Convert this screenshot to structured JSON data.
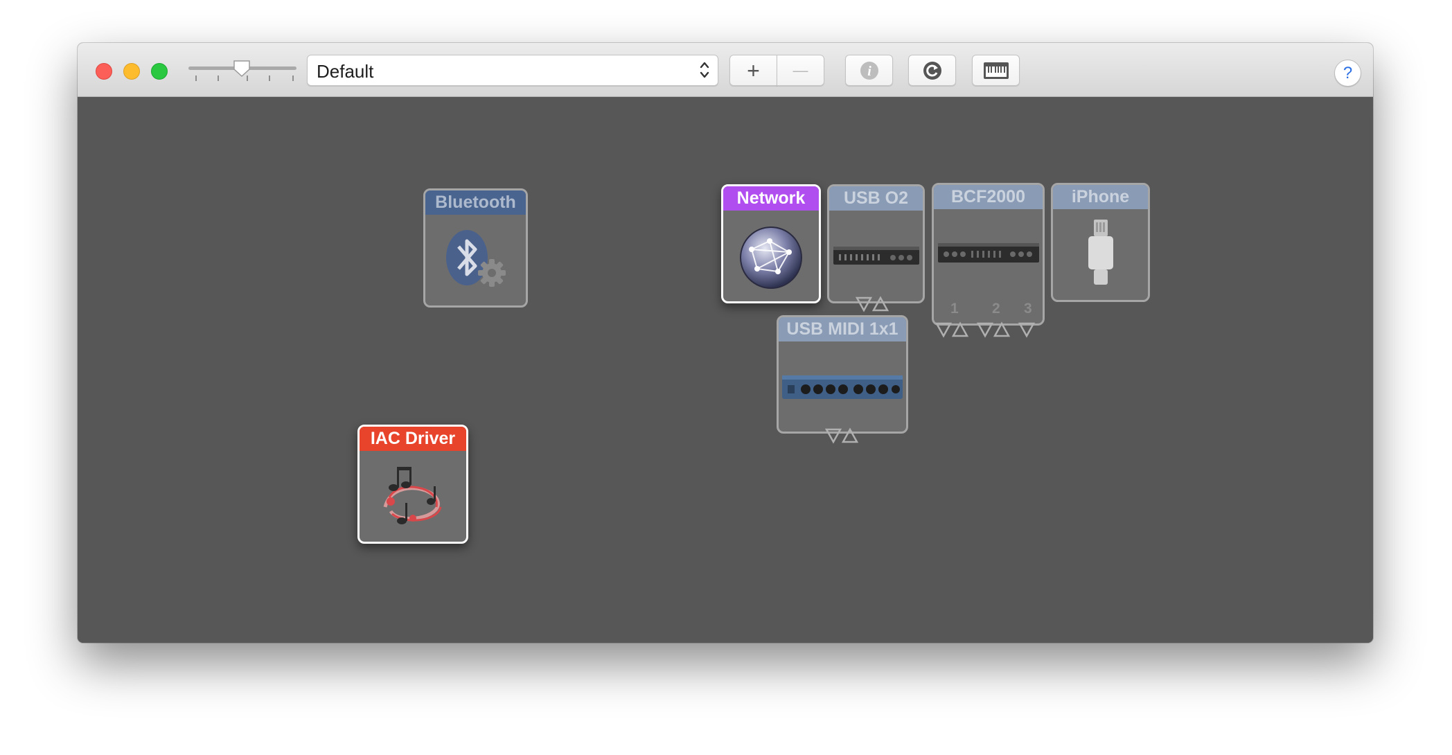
{
  "toolbar": {
    "configuration_value": "Default",
    "add_label": "+",
    "remove_label": "—",
    "help_label": "?"
  },
  "devices": [
    {
      "name": "Bluetooth",
      "icon": "bluetooth-icon",
      "active": false,
      "color": "#4a6490"
    },
    {
      "name": "IAC Driver",
      "icon": "iac-driver-icon",
      "active": true,
      "color": "#e8432b"
    },
    {
      "name": "Network",
      "icon": "network-globe-icon",
      "active": true,
      "color": "#b04ef0"
    },
    {
      "name": "USB O2",
      "icon": "usb-o2-icon",
      "active": false,
      "color": "#8a9bb6"
    },
    {
      "name": "BCF2000",
      "icon": "bcf2000-icon",
      "active": false,
      "color": "#8a9bb6",
      "port_labels": [
        "1",
        "2",
        "3"
      ]
    },
    {
      "name": "iPhone",
      "icon": "lightning-connector-icon",
      "active": false,
      "color": "#8a9bb6"
    },
    {
      "name": "USB MIDI 1x1",
      "icon": "usb-midi-icon",
      "active": false,
      "color": "#8a9bb6"
    }
  ]
}
